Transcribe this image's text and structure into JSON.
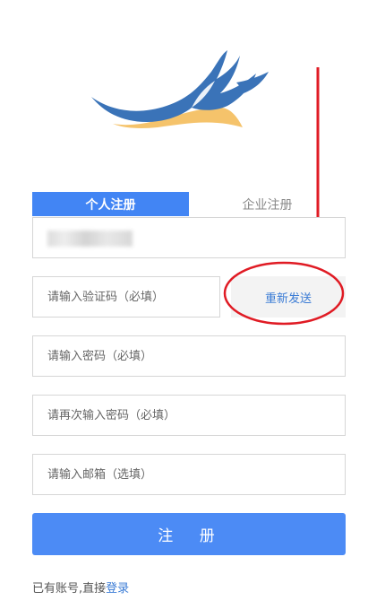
{
  "tabs": {
    "personal": "个人注册",
    "enterprise": "企业注册",
    "active": "personal"
  },
  "form": {
    "phone_value": "",
    "code_placeholder": "请输入验证码（必填）",
    "resend_label": "重新发送",
    "password_placeholder": "请输入密码（必填）",
    "password_confirm_placeholder": "请再次输入密码（必填）",
    "email_placeholder": "请输入邮箱（选填）",
    "submit_label": "注 册"
  },
  "footer": {
    "prompt": "已有账号,直接",
    "login_link": "登录"
  },
  "colors": {
    "primary": "#4285f4",
    "button": "#4c8bf5",
    "link": "#3a7bd5",
    "logo_blue": "#3a73b8",
    "logo_gold": "#f5c36b",
    "annotation_red": "#e01b24"
  },
  "icons": {
    "logo": "wing-logo",
    "annotation": "red-arrow-and-circle"
  }
}
